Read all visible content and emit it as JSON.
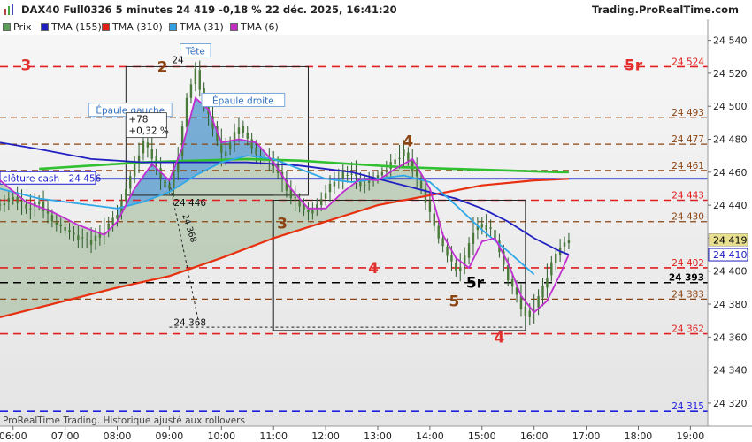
{
  "header": {
    "title": "DAX40 Full0326 5 minutes 24 419 -0,18 % 22 déc. 2025, 16:41:20",
    "brand": "Trading.ProRealTime.com"
  },
  "legend": [
    {
      "label": "Prix",
      "color": "#5a9e5a"
    },
    {
      "label": "TMA (155)",
      "color": "#2020c0"
    },
    {
      "label": "TMA (310)",
      "color": "#e02010"
    },
    {
      "label": "TMA (31)",
      "color": "#30a0e0"
    },
    {
      "label": "TMA (6)",
      "color": "#c030c0"
    }
  ],
  "footer": "ProRealTime Trading. Historique ajusté aux rollovers",
  "chart_data": {
    "type": "line",
    "y_range": [
      24306,
      24543
    ],
    "x_range": [
      "05:45",
      "19:20"
    ],
    "y_ticks": [
      "24 540",
      "24 520",
      "24 500",
      "24 480",
      "24 460",
      "24 440",
      "24 420",
      "24 400",
      "24 380",
      "24 360",
      "24 340",
      "24 320"
    ],
    "x_ticks": [
      "06:00",
      "07:00",
      "08:00",
      "09:00",
      "10:00",
      "11:00",
      "12:00",
      "13:00",
      "14:00",
      "15:00",
      "16:00",
      "17:00",
      "18:00",
      "19:00"
    ],
    "last_price": {
      "label": "24 419",
      "value": 24419
    },
    "tma155_last": {
      "label": "24 410",
      "value": 24410
    },
    "close_cash": {
      "label": "clôture cash -  24 456",
      "value": 24456
    },
    "levels": [
      {
        "value": 24524,
        "label": "24 524",
        "color": "#e02020",
        "dash": "red"
      },
      {
        "value": 24493,
        "label": "24 493",
        "color": "#8b4513",
        "dash": "brown"
      },
      {
        "value": 24477,
        "label": "24 477",
        "color": "#8b4513",
        "dash": "brown"
      },
      {
        "value": 24461,
        "label": "24 461",
        "color": "#8b4513",
        "dash": "brown"
      },
      {
        "value": 24443,
        "label": "24 443",
        "color": "#e02020",
        "dash": "red"
      },
      {
        "value": 24430,
        "label": "24 430",
        "color": "#8b4513",
        "dash": "brown"
      },
      {
        "value": 24402,
        "label": "24 402",
        "color": "#e02020",
        "dash": "red"
      },
      {
        "value": 24393,
        "label": "24 393",
        "color": "#000000",
        "dash": "black"
      },
      {
        "value": 24383,
        "label": "24 383",
        "color": "#8b4513",
        "dash": "brown"
      },
      {
        "value": 24362,
        "label": "24 362",
        "color": "#e02020",
        "dash": "red"
      },
      {
        "value": 24315,
        "label": "24 315",
        "color": "#2020e0",
        "dash": "blue"
      }
    ],
    "wave_labels": [
      {
        "text": "3",
        "t": "06:15",
        "y": 24525,
        "color": "#e03030"
      },
      {
        "text": "2",
        "t": "08:52",
        "y": 24524,
        "color": "#8b4513"
      },
      {
        "text": "4",
        "t": "13:35",
        "y": 24479,
        "color": "#8b4513"
      },
      {
        "text": "3",
        "t": "11:10",
        "y": 24429,
        "color": "#8b4513"
      },
      {
        "text": "4",
        "t": "12:55",
        "y": 24402,
        "color": "#e03030"
      },
      {
        "text": "5r",
        "t": "14:52",
        "y": 24393,
        "color": "#000000"
      },
      {
        "text": "5",
        "t": "14:28",
        "y": 24382,
        "color": "#8b4513"
      },
      {
        "text": "4",
        "t": "15:20",
        "y": 24360,
        "color": "#e03030"
      },
      {
        "text": "5r",
        "t": "15:05",
        "y": 24525,
        "color": "#e03030",
        "right_side": true
      }
    ],
    "annotations": [
      {
        "text": "Tête",
        "t": "09:30",
        "y": 24532
      },
      {
        "text": "Épaule gauche",
        "t": "08:15",
        "y": 24496
      },
      {
        "text": "Épaule droite",
        "t": "10:25",
        "y": 24502
      }
    ],
    "measure": {
      "line1": "+78",
      "line2": "+0,32 %",
      "low": "24 446",
      "low2": "24 368",
      "low3": "24 368",
      "top_label": "24"
    },
    "price_series": {
      "t": [
        "05:45",
        "06:00",
        "06:15",
        "06:30",
        "06:45",
        "07:00",
        "07:15",
        "07:30",
        "07:45",
        "08:00",
        "08:10",
        "08:20",
        "08:30",
        "08:40",
        "08:50",
        "09:00",
        "09:10",
        "09:20",
        "09:30",
        "09:40",
        "09:50",
        "10:00",
        "10:10",
        "10:20",
        "10:30",
        "10:40",
        "10:50",
        "11:00",
        "11:10",
        "11:20",
        "11:30",
        "11:40",
        "11:50",
        "12:00",
        "12:10",
        "12:20",
        "12:30",
        "12:40",
        "12:50",
        "13:00",
        "13:10",
        "13:20",
        "13:30",
        "13:40",
        "13:50",
        "14:00",
        "14:10",
        "14:20",
        "14:30",
        "14:40",
        "14:50",
        "15:00",
        "15:10",
        "15:20",
        "15:30",
        "15:40",
        "15:50",
        "16:00",
        "16:10",
        "16:20",
        "16:30",
        "16:40"
      ],
      "v": [
        24440,
        24445,
        24438,
        24442,
        24430,
        24425,
        24420,
        24418,
        24425,
        24435,
        24450,
        24465,
        24478,
        24470,
        24455,
        24450,
        24470,
        24505,
        24522,
        24500,
        24488,
        24470,
        24478,
        24488,
        24480,
        24470,
        24468,
        24465,
        24455,
        24445,
        24440,
        24435,
        24440,
        24448,
        24455,
        24458,
        24460,
        24452,
        24455,
        24458,
        24462,
        24468,
        24472,
        24462,
        24450,
        24435,
        24420,
        24410,
        24400,
        24408,
        24425,
        24428,
        24425,
        24412,
        24395,
        24385,
        24372,
        24378,
        24390,
        24405,
        24415,
        24419
      ]
    },
    "tma6": {
      "t": [
        "05:45",
        "06:15",
        "06:45",
        "07:15",
        "07:45",
        "08:00",
        "08:20",
        "08:40",
        "09:00",
        "09:15",
        "09:30",
        "09:45",
        "10:00",
        "10:20",
        "10:40",
        "11:00",
        "11:20",
        "11:40",
        "12:00",
        "12:20",
        "12:40",
        "13:00",
        "13:20",
        "13:40",
        "14:00",
        "14:15",
        "14:30",
        "14:45",
        "15:00",
        "15:15",
        "15:30",
        "15:45",
        "16:00",
        "16:15",
        "16:30",
        "16:40"
      ],
      "v": [
        24455,
        24442,
        24436,
        24428,
        24422,
        24430,
        24450,
        24465,
        24455,
        24475,
        24505,
        24498,
        24478,
        24480,
        24478,
        24466,
        24450,
        24438,
        24438,
        24448,
        24456,
        24455,
        24462,
        24468,
        24450,
        24422,
        24408,
        24402,
        24418,
        24420,
        24405,
        24385,
        24375,
        24382,
        24398,
        24410
      ]
    },
    "tma31": {
      "t": [
        "05:45",
        "06:30",
        "07:30",
        "08:00",
        "08:30",
        "09:00",
        "09:30",
        "10:00",
        "10:30",
        "11:00",
        "11:30",
        "12:00",
        "12:30",
        "13:00",
        "13:30",
        "14:00",
        "14:30",
        "15:00",
        "15:30",
        "16:00"
      ],
      "v": [
        24450,
        24444,
        24440,
        24438,
        24442,
        24448,
        24458,
        24466,
        24470,
        24468,
        24462,
        24456,
        24454,
        24456,
        24458,
        24454,
        24440,
        24425,
        24412,
        24398
      ]
    },
    "tma155": {
      "t": [
        "05:45",
        "06:30",
        "07:30",
        "08:30",
        "09:30",
        "10:30",
        "11:30",
        "12:30",
        "13:30",
        "14:00",
        "14:30",
        "15:00",
        "15:30",
        "16:00",
        "16:30",
        "16:40"
      ],
      "v": [
        24478,
        24474,
        24468,
        24466,
        24466,
        24466,
        24464,
        24460,
        24452,
        24448,
        24444,
        24438,
        24430,
        24420,
        24412,
        24410
      ]
    },
    "tma310": {
      "t": [
        "05:45",
        "07:00",
        "08:00",
        "09:00",
        "10:00",
        "11:00",
        "12:00",
        "13:00",
        "14:00",
        "15:00",
        "16:00",
        "16:40"
      ],
      "v": [
        24372,
        24382,
        24390,
        24397,
        24408,
        24420,
        24430,
        24440,
        24446,
        24452,
        24455,
        24456
      ]
    },
    "green_tma": {
      "t": [
        "06:30",
        "07:30",
        "08:30",
        "09:30",
        "10:30",
        "11:30",
        "12:30",
        "13:30",
        "14:30",
        "15:30",
        "16:30",
        "16:40"
      ],
      "v": [
        24462,
        24464,
        24466,
        24467,
        24468,
        24467,
        24465,
        24463,
        24462,
        24461,
        24460,
        24460
      ]
    }
  }
}
